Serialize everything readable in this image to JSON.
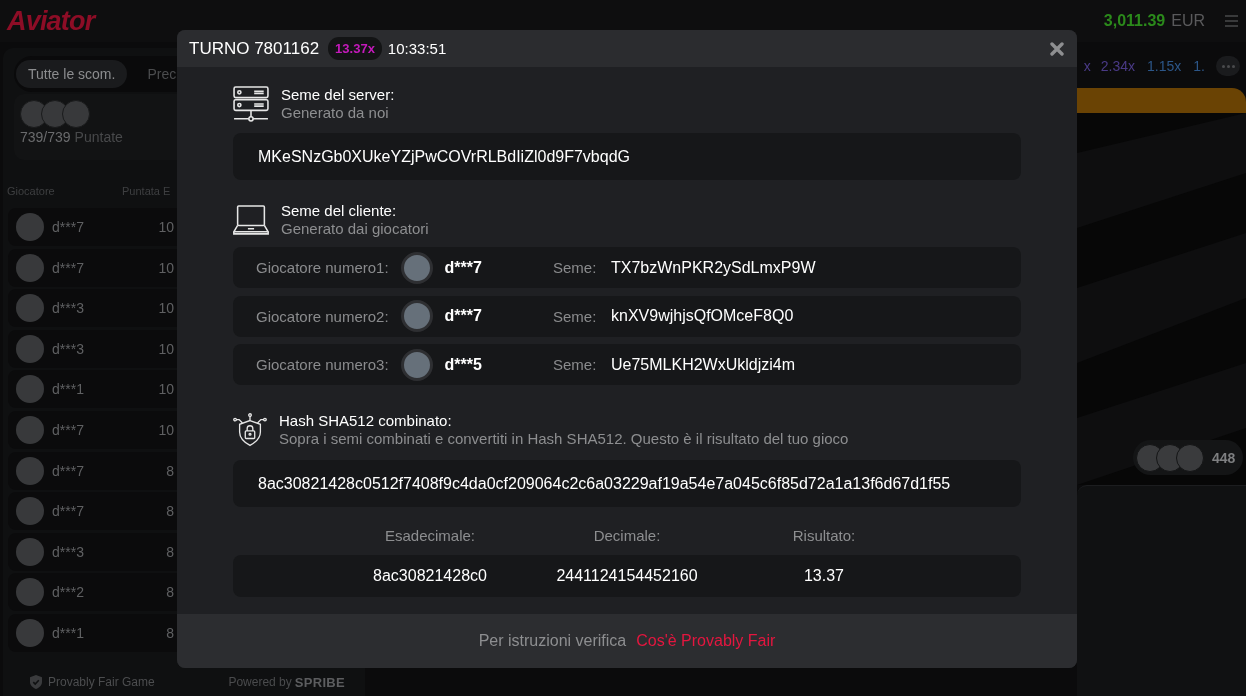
{
  "top_bar": {
    "logo": "Aviator",
    "balance": "3,011.39",
    "currency": "EUR"
  },
  "left_panel": {
    "tabs": [
      {
        "label": "Tutte le scom.",
        "selected": true
      },
      {
        "label": "Prec",
        "selected": false
      }
    ],
    "bets_count": "739/739",
    "bets_label": "Puntate",
    "columns": [
      "Giocatore",
      "Puntata E"
    ],
    "rows": [
      {
        "player": "d***7",
        "bet": "10"
      },
      {
        "player": "d***7",
        "bet": "10"
      },
      {
        "player": "d***3",
        "bet": "10"
      },
      {
        "player": "d***3",
        "bet": "10"
      },
      {
        "player": "d***1",
        "bet": "10"
      },
      {
        "player": "d***7",
        "bet": "10"
      },
      {
        "player": "d***7",
        "bet": "8"
      },
      {
        "player": "d***7",
        "bet": "8"
      },
      {
        "player": "d***3",
        "bet": "8"
      },
      {
        "player": "d***2",
        "bet": "8"
      },
      {
        "player": "d***1",
        "bet": "8"
      }
    ],
    "footer": {
      "label": "Provably Fair Game",
      "powered_by": "Powered by",
      "brand": "SPRIBE"
    }
  },
  "history": {
    "multipliers": [
      {
        "value": "x",
        "color": "#4a3a86"
      },
      {
        "value": "2.34x",
        "color": "#4a3a86"
      },
      {
        "value": "1.15x",
        "color": "#2c5688"
      },
      {
        "value": "1.",
        "color": "#2c5688"
      }
    ]
  },
  "game": {
    "players_count": "448"
  },
  "modal": {
    "title": "TURNO 7801162",
    "multiplier": "13.37x",
    "time": "10:33:51",
    "server_seed": {
      "title": "Seme del server:",
      "subtitle": "Generato da noi",
      "value": "MKeSNzGb0XUkeYZjPwCOVrRLBdIiZl0d9F7vbqdG"
    },
    "client_seed": {
      "title": "Seme del cliente:",
      "subtitle": "Generato dai giocatori",
      "players": [
        {
          "label": "Giocatore numero1:",
          "name": "d***7",
          "seed_label": "Seme:",
          "seed": "TX7bzWnPKR2ySdLmxP9W"
        },
        {
          "label": "Giocatore numero2:",
          "name": "d***7",
          "seed_label": "Seme:",
          "seed": "knXV9wjhjsQfOMceF8Q0"
        },
        {
          "label": "Giocatore numero3:",
          "name": "d***5",
          "seed_label": "Seme:",
          "seed": "Ue75MLKH2WxUkldjzi4m"
        }
      ]
    },
    "hash": {
      "title": "Hash SHA512 combinato:",
      "subtitle": "Sopra i semi combinati e convertiti in Hash SHA512. Questo è il risultato del tuo gioco",
      "value": "8ac30821428c0512f7408f9c4da0cf209064c2c6a03229af19a54e7a045c6f85d72a1a13f6d67d1f55"
    },
    "results": [
      {
        "label": "Esadecimale:",
        "value": "8ac30821428c0"
      },
      {
        "label": "Decimale:",
        "value": "2441124154452160"
      },
      {
        "label": "Risultato:",
        "value": "13.37"
      }
    ],
    "footer": {
      "text": "Per istruzioni verifica",
      "link": "Cos'è Provably Fair"
    }
  }
}
